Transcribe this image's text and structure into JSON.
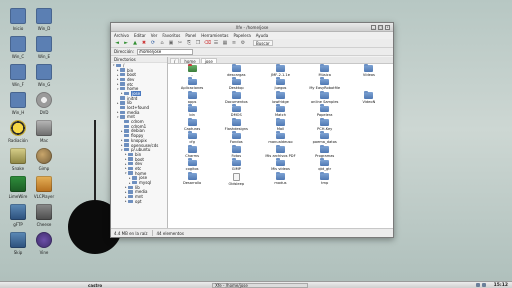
{
  "desktop": {
    "icons": [
      {
        "label": "Inicio",
        "icon": "home-folder-icon",
        "cls": "",
        "col": 0,
        "row": 0
      },
      {
        "label": "Win_D",
        "icon": "windows-drive-icon",
        "cls": "",
        "col": 1,
        "row": 0
      },
      {
        "label": "Win_C",
        "icon": "windows-drive-icon",
        "cls": "",
        "col": 0,
        "row": 1
      },
      {
        "label": "Win_E",
        "icon": "windows-drive-icon",
        "cls": "",
        "col": 1,
        "row": 1
      },
      {
        "label": "Win_F",
        "icon": "windows-drive-icon",
        "cls": "",
        "col": 0,
        "row": 2
      },
      {
        "label": "Win_G",
        "icon": "windows-drive-icon",
        "cls": "",
        "col": 1,
        "row": 2
      },
      {
        "label": "Win_H",
        "icon": "windows-drive-icon",
        "cls": "",
        "col": 0,
        "row": 3
      },
      {
        "label": "DVD",
        "icon": "dvd-icon",
        "cls": "dvd",
        "col": 1,
        "row": 3
      },
      {
        "label": "Radiación",
        "icon": "radiation-icon",
        "cls": "radio",
        "col": 0,
        "row": 4
      },
      {
        "label": "Mac",
        "icon": "mac-icon",
        "cls": "mac",
        "col": 1,
        "row": 4
      },
      {
        "label": "Snake",
        "icon": "game-icon",
        "cls": "game",
        "col": 0,
        "row": 5
      },
      {
        "label": "Gimp",
        "icon": "gimp-icon",
        "cls": "gimp",
        "col": 1,
        "row": 5
      },
      {
        "label": "LimeWire",
        "icon": "limewire-icon",
        "cls": "media",
        "col": 0,
        "row": 6
      },
      {
        "label": "VLCPlayer",
        "icon": "media-player-icon",
        "cls": "mp",
        "col": 1,
        "row": 6
      },
      {
        "label": "gFTP",
        "icon": "ftp-icon",
        "cls": "net",
        "col": 0,
        "row": 7
      },
      {
        "label": "Cheese",
        "icon": "camera-icon",
        "cls": "cam",
        "col": 1,
        "row": 7
      },
      {
        "label": "Skip",
        "icon": "network-icon",
        "cls": "net",
        "col": 0,
        "row": 8
      },
      {
        "label": "Vine",
        "icon": "moon-icon",
        "cls": "moon",
        "col": 1,
        "row": 8
      }
    ]
  },
  "window": {
    "title": "Xfe - /home/jose",
    "buttons": {
      "minimize": "_",
      "maximize": "□",
      "close": "x"
    },
    "menu": [
      "Archivo",
      "Editar",
      "Ver",
      "Favoritos",
      "Panel",
      "Herramientas",
      "Papelera",
      "Ayuda"
    ],
    "toolbar": {
      "buttons": [
        {
          "glyph": "◄",
          "name": "back-button",
          "cls": "green"
        },
        {
          "glyph": "►",
          "name": "forward-button",
          "cls": "green"
        },
        {
          "glyph": "▲",
          "name": "up-button",
          "cls": "green"
        },
        {
          "glyph": "✖",
          "name": "stop-button",
          "cls": "red"
        },
        {
          "glyph": "⟳",
          "name": "refresh-button",
          "cls": "blue"
        },
        {
          "glyph": "⌂",
          "name": "home-button",
          "cls": "gray"
        },
        {
          "glyph": "▣",
          "name": "terminal-button",
          "cls": "gray"
        },
        {
          "glyph": "✂",
          "name": "cut-button",
          "cls": "gray"
        },
        {
          "glyph": "⎘",
          "name": "copy-button",
          "cls": "gray"
        },
        {
          "glyph": "❐",
          "name": "paste-button",
          "cls": "gray"
        },
        {
          "glyph": "⌫",
          "name": "delete-button",
          "cls": "red"
        },
        {
          "glyph": "☰",
          "name": "list-view-button",
          "cls": "gray"
        },
        {
          "glyph": "▦",
          "name": "icon-view-button",
          "cls": "gray"
        },
        {
          "glyph": "≡",
          "name": "details-view-button",
          "cls": "gray"
        },
        {
          "glyph": "⚙",
          "name": "options-button",
          "cls": "gray"
        }
      ],
      "search_label": "Buscar"
    },
    "location": {
      "label": "Dirección:",
      "value": "/home/jose"
    },
    "sidebar": {
      "header": "Directorios",
      "tree": [
        {
          "label": "/",
          "depth": 0,
          "exp": "▾"
        },
        {
          "label": "bin",
          "depth": 1,
          "exp": "▸"
        },
        {
          "label": "boot",
          "depth": 1,
          "exp": "▸"
        },
        {
          "label": "dev",
          "depth": 1,
          "exp": "▸"
        },
        {
          "label": "etc",
          "depth": 1,
          "exp": "▸"
        },
        {
          "label": "home",
          "depth": 1,
          "exp": "▾"
        },
        {
          "label": "jose",
          "depth": 2,
          "exp": "▸",
          "selected": true
        },
        {
          "label": "initrd",
          "depth": 1,
          "exp": ""
        },
        {
          "label": "lib",
          "depth": 1,
          "exp": "▸"
        },
        {
          "label": "lost+found",
          "depth": 1,
          "exp": ""
        },
        {
          "label": "media",
          "depth": 1,
          "exp": "▸"
        },
        {
          "label": "mnt",
          "depth": 1,
          "exp": "▾"
        },
        {
          "label": "cdrom",
          "depth": 2,
          "exp": ""
        },
        {
          "label": "cdrom1",
          "depth": 2,
          "exp": ""
        },
        {
          "label": "debian",
          "depth": 2,
          "exp": "▸"
        },
        {
          "label": "floppy",
          "depth": 2,
          "exp": ""
        },
        {
          "label": "knoppix",
          "depth": 2,
          "exp": "▸"
        },
        {
          "label": "opensuse/cds",
          "depth": 2,
          "exp": "▸"
        },
        {
          "label": "p/.ubuntu",
          "depth": 2,
          "exp": "▾"
        },
        {
          "label": "bin",
          "depth": 3,
          "exp": "▸"
        },
        {
          "label": "boot",
          "depth": 3,
          "exp": "▸"
        },
        {
          "label": "dev",
          "depth": 3,
          "exp": "▸"
        },
        {
          "label": "etc",
          "depth": 3,
          "exp": "▸"
        },
        {
          "label": "home",
          "depth": 3,
          "exp": "▾"
        },
        {
          "label": "jose",
          "depth": 4,
          "exp": "▸"
        },
        {
          "label": "mysql",
          "depth": 4,
          "exp": "▸"
        },
        {
          "label": "lib",
          "depth": 3,
          "exp": "▸"
        },
        {
          "label": "media",
          "depth": 3,
          "exp": "▸"
        },
        {
          "label": "mnt",
          "depth": 3,
          "exp": "▸"
        },
        {
          "label": "opt",
          "depth": 3,
          "exp": "▸"
        }
      ]
    },
    "tabs": [
      {
        "label": "/",
        "active": false
      },
      {
        "label": "home",
        "active": false
      },
      {
        "label": "jose",
        "active": true
      }
    ],
    "files": [
      {
        "name": "..",
        "type": "home"
      },
      {
        "name": "descargas",
        "type": "folder"
      },
      {
        "name": "JMF-2.1.1e",
        "type": "folder"
      },
      {
        "name": "Música",
        "type": "folder"
      },
      {
        "name": "Vídeos",
        "type": "folder"
      },
      {
        "name": "Aplicaciones",
        "type": "folder"
      },
      {
        "name": "Desktop",
        "type": "folder"
      },
      {
        "name": "Juegos",
        "type": "folder"
      },
      {
        "name": "My EasyRobotfile",
        "type": "folder"
      },
      {
        "name": "",
        "type": "none"
      },
      {
        "name": "apps",
        "type": "folder"
      },
      {
        "name": "Documentos",
        "type": "folder"
      },
      {
        "name": "lowfridge",
        "type": "folder"
      },
      {
        "name": "online Samples",
        "type": "folder"
      },
      {
        "name": "VideoN",
        "type": "folder"
      },
      {
        "name": "bin",
        "type": "folder"
      },
      {
        "name": "DMOS",
        "type": "folder"
      },
      {
        "name": "Match",
        "type": "folder"
      },
      {
        "name": "Papelera",
        "type": "folder"
      },
      {
        "name": "",
        "type": "none"
      },
      {
        "name": "Capturas",
        "type": "folder"
      },
      {
        "name": "Flashdesigns",
        "type": "folder"
      },
      {
        "name": "Mail",
        "type": "folder"
      },
      {
        "name": "PCH-Key",
        "type": "folder"
      },
      {
        "name": "",
        "type": "none"
      },
      {
        "name": "cfg",
        "type": "folder"
      },
      {
        "name": "Fondos",
        "type": "folder"
      },
      {
        "name": "manualdeuso",
        "type": "folder"
      },
      {
        "name": "poema_datos",
        "type": "folder"
      },
      {
        "name": "",
        "type": "none"
      },
      {
        "name": "Charms",
        "type": "folder"
      },
      {
        "name": "Fotos",
        "type": "folder"
      },
      {
        "name": "Mis archivos PDF",
        "type": "folder"
      },
      {
        "name": "Programas",
        "type": "folder"
      },
      {
        "name": "",
        "type": "none"
      },
      {
        "name": "cogitos",
        "type": "folder"
      },
      {
        "name": "GIMP",
        "type": "folder"
      },
      {
        "name": "Mis vídeos",
        "type": "folder"
      },
      {
        "name": "qbt_gtr",
        "type": "folder"
      },
      {
        "name": "",
        "type": "none"
      },
      {
        "name": "Desarrollo",
        "type": "folder"
      },
      {
        "name": "Oldsleep",
        "type": "file"
      },
      {
        "name": "modus",
        "type": "folder"
      },
      {
        "name": "tmp",
        "type": "folder"
      }
    ],
    "status": {
      "left": "4.4 MB en la raíz",
      "count": "44 elementos"
    }
  },
  "panel": {
    "start_label": "castro",
    "task_label": "Xfe - /home/jose",
    "clock": "15:12"
  }
}
